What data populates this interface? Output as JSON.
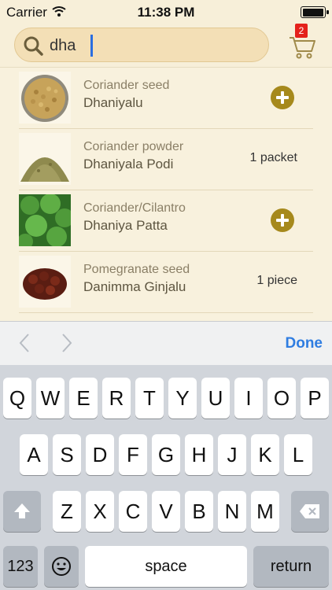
{
  "status_bar": {
    "carrier": "Carrier",
    "time": "11:38 PM"
  },
  "search": {
    "value": "dha",
    "icon": "search-icon"
  },
  "cart": {
    "count": "2",
    "icon": "cart-icon"
  },
  "items": [
    {
      "english": "Coriander seed",
      "telugu": "Dhaniyalu",
      "quantity": "",
      "action": "add"
    },
    {
      "english": "Coriander powder",
      "telugu": "Dhaniyala Podi",
      "quantity": "1 packet",
      "action": ""
    },
    {
      "english": "Coriander/Cilantro",
      "telugu": "Dhaniya Patta",
      "quantity": "",
      "action": "add"
    },
    {
      "english": "Pomegranate seed",
      "telugu": "Danimma Ginjalu",
      "quantity": "1 piece",
      "action": ""
    }
  ],
  "accessory": {
    "done_label": "Done"
  },
  "keyboard": {
    "row1": [
      "Q",
      "W",
      "E",
      "R",
      "T",
      "Y",
      "U",
      "I",
      "O",
      "P"
    ],
    "row2": [
      "A",
      "S",
      "D",
      "F",
      "G",
      "H",
      "J",
      "K",
      "L"
    ],
    "row3": [
      "Z",
      "X",
      "C",
      "V",
      "B",
      "N",
      "M"
    ],
    "numbers_label": "123",
    "space_label": "space",
    "return_label": "return"
  },
  "colors": {
    "accent": "#a6891c",
    "done": "#2f7de1",
    "badge": "#e4211b"
  }
}
